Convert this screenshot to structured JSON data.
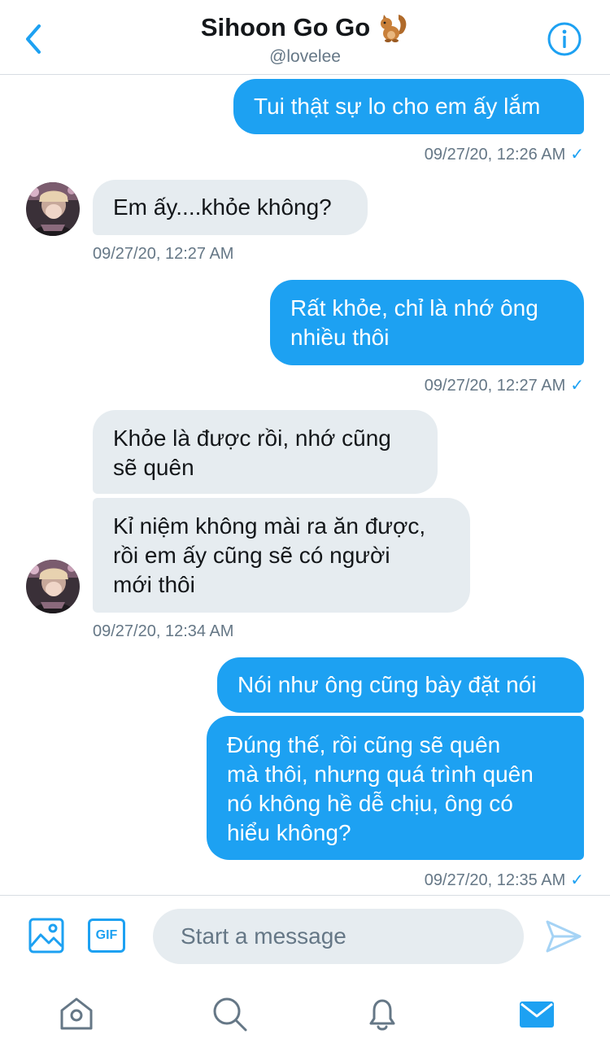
{
  "header": {
    "title": "Sihoon Go Go",
    "title_emoji": "squirrel-emoji",
    "handle": "@lovelee"
  },
  "messages": [
    {
      "from": "me",
      "text": "Tui thật sự lo cho em ấy lắm",
      "time": "09/27/20, 12:26 AM",
      "read": true
    },
    {
      "from": "them",
      "text": "Em ấy....khỏe không?",
      "time": "09/27/20, 12:27 AM"
    },
    {
      "from": "me",
      "text": "Rất khỏe, chỉ là nhớ ông\nnhiều thôi",
      "time": "09/27/20, 12:27 AM",
      "read": true
    },
    {
      "from": "them",
      "text": "Khỏe là được rồi, nhớ cũng\nsẽ quên"
    },
    {
      "from": "them",
      "text": "Kỉ niệm không mài ra ăn được,\nrồi em ấy cũng sẽ có người\nmới thôi",
      "time": "09/27/20, 12:34 AM"
    },
    {
      "from": "me",
      "text": "Nói như ông cũng bày đặt nói"
    },
    {
      "from": "me",
      "text": "Đúng thế, rồi cũng sẽ quên\nmà thôi, nhưng quá trình quên\nnó không hề dễ chịu, ông có\nhiểu không?",
      "time": "09/27/20, 12:35 AM",
      "read": true
    }
  ],
  "read_mark": "✓",
  "composer": {
    "gif_label": "GIF",
    "placeholder": "Start a message"
  },
  "icons": {
    "back": "chevron-left-icon",
    "info": "info-icon",
    "image": "image-icon",
    "gif": "gif-icon",
    "send": "send-icon",
    "home": "home-icon",
    "search": "search-icon",
    "notifications": "bell-icon",
    "messages": "envelope-icon"
  },
  "colors": {
    "accent": "#1da1f2",
    "incoming_bubble": "#e6ecf0",
    "secondary_text": "#657786"
  }
}
